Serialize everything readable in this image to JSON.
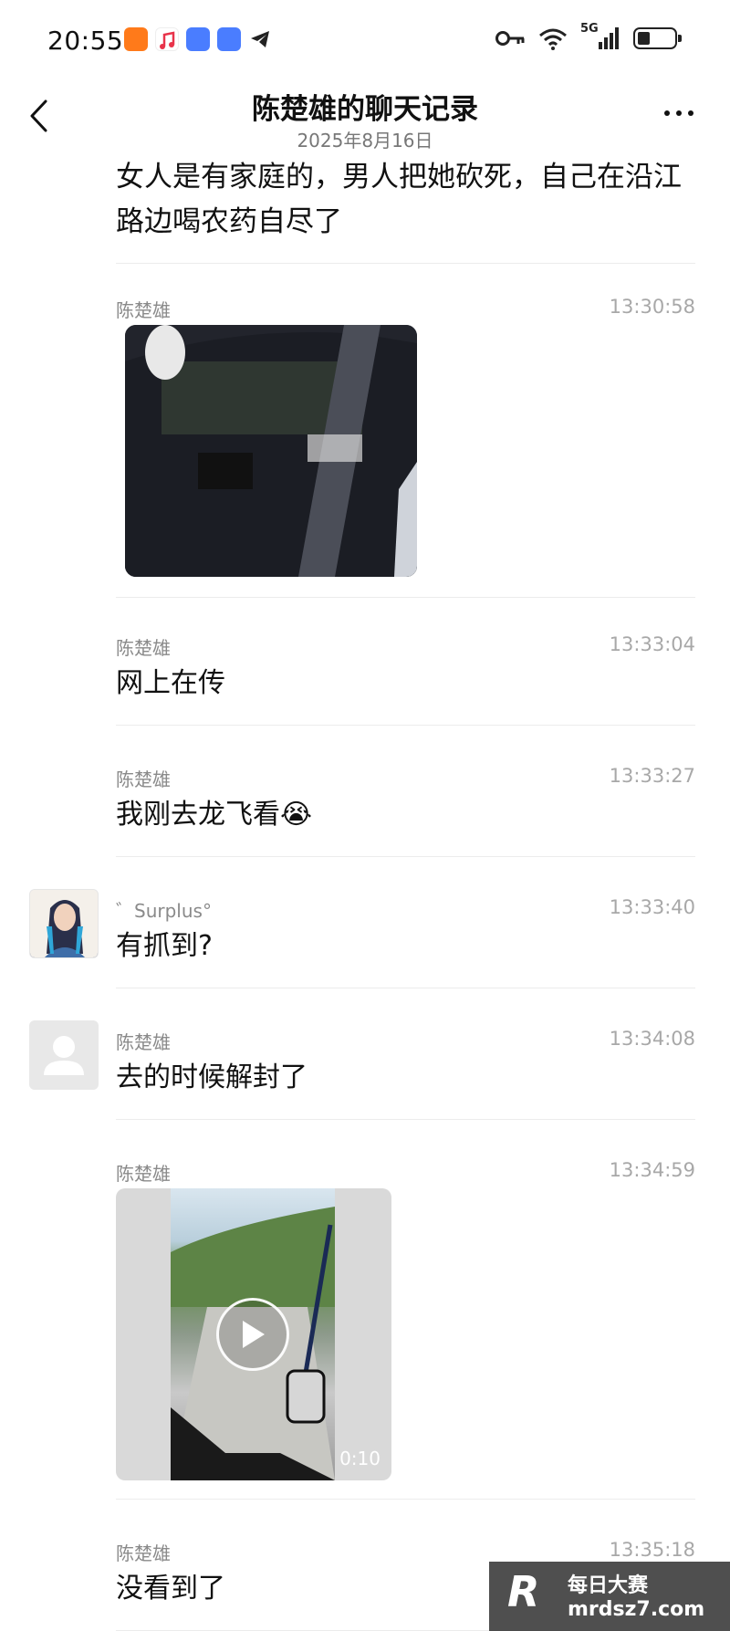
{
  "status_bar": {
    "time": "20:55",
    "network": "5G"
  },
  "header": {
    "title": "陈楚雄的聊天记录",
    "date": "2025年8月16日"
  },
  "messages": [
    {
      "text": "女人是有家庭的，男人把她砍死，自己在沿江路边喝农药自尽了"
    },
    {
      "sender": "陈楚雄",
      "time": "13:30:58",
      "type": "image"
    },
    {
      "sender": "陈楚雄",
      "time": "13:33:04",
      "text": "网上在传"
    },
    {
      "sender": "陈楚雄",
      "time": "13:33:27",
      "text": "我刚去龙飞看😭"
    },
    {
      "sender": "゛Surplus°",
      "time": "13:33:40",
      "text": "有抓到?"
    },
    {
      "sender": "陈楚雄",
      "time": "13:34:08",
      "text": "去的时候解封了"
    },
    {
      "sender": "陈楚雄",
      "time": "13:34:59",
      "type": "video",
      "duration": "0:10"
    },
    {
      "sender": "陈楚雄",
      "time": "13:35:18",
      "text": "没看到了"
    }
  ],
  "watermark": {
    "logo": "R",
    "line1": "每日大赛",
    "line2": "mrdsz7.com"
  }
}
